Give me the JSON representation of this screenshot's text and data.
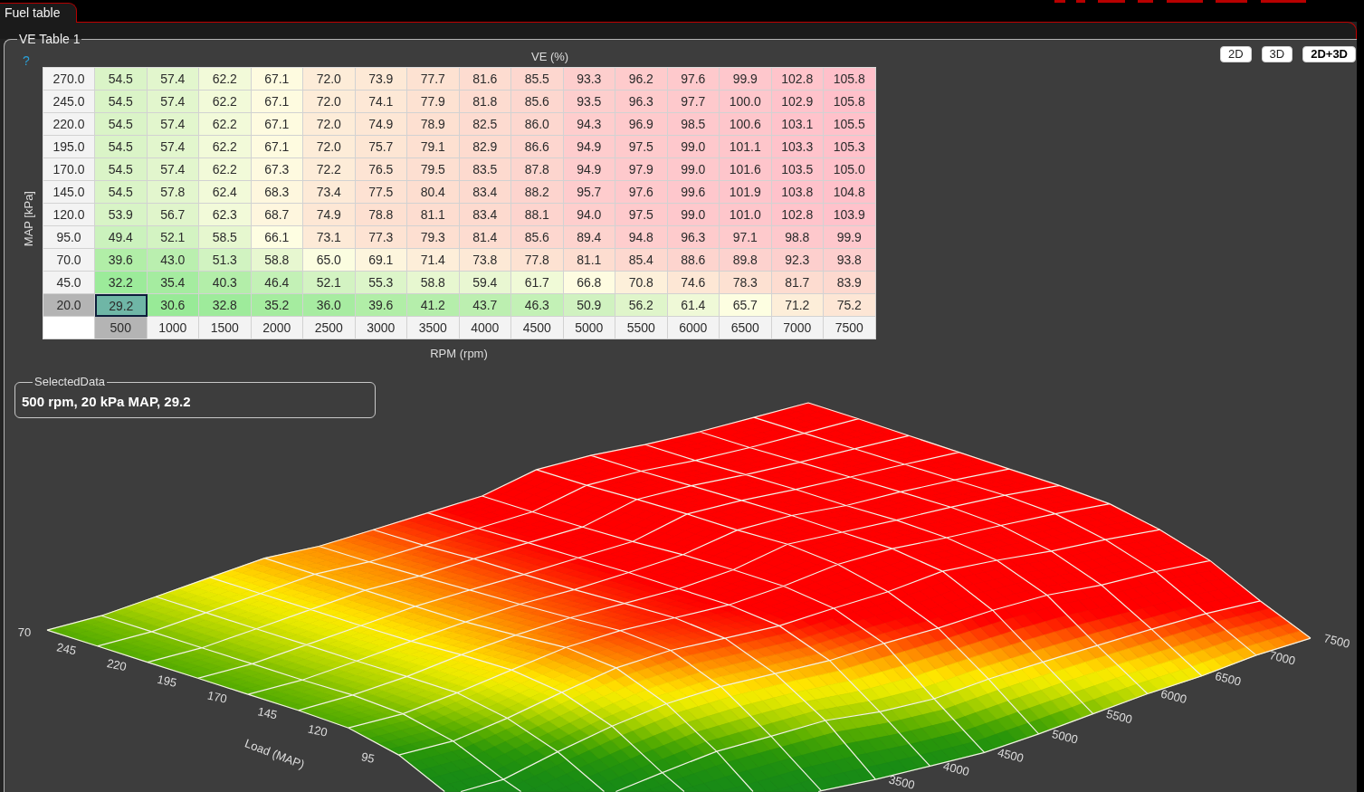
{
  "tabs": [
    {
      "label": "Fuel table",
      "selected": true
    }
  ],
  "ve_table": {
    "title": "VE Table 1",
    "help": "?",
    "value_label": "VE (%)",
    "view_buttons": [
      {
        "label": "2D",
        "selected": false
      },
      {
        "label": "3D",
        "selected": false
      },
      {
        "label": "2D+3D",
        "selected": true
      }
    ],
    "y_axis_label": "MAP [kPa]",
    "x_axis_label": "RPM (rpm)",
    "columns": [
      {
        "label": "500",
        "selected": true
      },
      {
        "label": "1000",
        "selected": false
      },
      {
        "label": "1500",
        "selected": false
      },
      {
        "label": "2000",
        "selected": false
      },
      {
        "label": "2500",
        "selected": false
      },
      {
        "label": "3000",
        "selected": false
      },
      {
        "label": "3500",
        "selected": false
      },
      {
        "label": "4000",
        "selected": false
      },
      {
        "label": "4500",
        "selected": false
      },
      {
        "label": "5000",
        "selected": false
      },
      {
        "label": "5500",
        "selected": false
      },
      {
        "label": "6000",
        "selected": false
      },
      {
        "label": "6500",
        "selected": false
      },
      {
        "label": "7000",
        "selected": false
      },
      {
        "label": "7500",
        "selected": false
      }
    ],
    "rows": [
      {
        "label": "270.0",
        "selected": false,
        "values": [
          "54.5",
          "57.4",
          "62.2",
          "67.1",
          "72.0",
          "73.9",
          "77.7",
          "81.6",
          "85.5",
          "93.3",
          "96.2",
          "97.6",
          "99.9",
          "102.8",
          "105.8"
        ]
      },
      {
        "label": "245.0",
        "selected": false,
        "values": [
          "54.5",
          "57.4",
          "62.2",
          "67.1",
          "72.0",
          "74.1",
          "77.9",
          "81.8",
          "85.6",
          "93.5",
          "96.3",
          "97.7",
          "100.0",
          "102.9",
          "105.8"
        ]
      },
      {
        "label": "220.0",
        "selected": false,
        "values": [
          "54.5",
          "57.4",
          "62.2",
          "67.1",
          "72.0",
          "74.9",
          "78.9",
          "82.5",
          "86.0",
          "94.3",
          "96.9",
          "98.5",
          "100.6",
          "103.1",
          "105.5"
        ]
      },
      {
        "label": "195.0",
        "selected": false,
        "values": [
          "54.5",
          "57.4",
          "62.2",
          "67.1",
          "72.0",
          "75.7",
          "79.1",
          "82.9",
          "86.6",
          "94.9",
          "97.5",
          "99.0",
          "101.1",
          "103.3",
          "105.3"
        ]
      },
      {
        "label": "170.0",
        "selected": false,
        "values": [
          "54.5",
          "57.4",
          "62.2",
          "67.3",
          "72.2",
          "76.5",
          "79.5",
          "83.5",
          "87.8",
          "94.9",
          "97.9",
          "99.0",
          "101.6",
          "103.5",
          "105.0"
        ]
      },
      {
        "label": "145.0",
        "selected": false,
        "values": [
          "54.5",
          "57.8",
          "62.4",
          "68.3",
          "73.4",
          "77.5",
          "80.4",
          "83.4",
          "88.2",
          "95.7",
          "97.6",
          "99.6",
          "101.9",
          "103.8",
          "104.8"
        ]
      },
      {
        "label": "120.0",
        "selected": false,
        "values": [
          "53.9",
          "56.7",
          "62.3",
          "68.7",
          "74.9",
          "78.8",
          "81.1",
          "83.4",
          "88.1",
          "94.0",
          "97.5",
          "99.0",
          "101.0",
          "102.8",
          "103.9"
        ]
      },
      {
        "label": "95.0",
        "selected": false,
        "values": [
          "49.4",
          "52.1",
          "58.5",
          "66.1",
          "73.1",
          "77.3",
          "79.3",
          "81.4",
          "85.6",
          "89.4",
          "94.8",
          "96.3",
          "97.1",
          "98.8",
          "99.9"
        ]
      },
      {
        "label": "70.0",
        "selected": false,
        "values": [
          "39.6",
          "43.0",
          "51.3",
          "58.8",
          "65.0",
          "69.1",
          "71.4",
          "73.8",
          "77.8",
          "81.1",
          "85.4",
          "88.6",
          "89.8",
          "92.3",
          "93.8"
        ]
      },
      {
        "label": "45.0",
        "selected": false,
        "values": [
          "32.2",
          "35.4",
          "40.3",
          "46.4",
          "52.1",
          "55.3",
          "58.8",
          "59.4",
          "61.7",
          "66.8",
          "70.8",
          "74.6",
          "78.3",
          "81.7",
          "83.9"
        ]
      },
      {
        "label": "20.0",
        "selected": true,
        "values": [
          "29.2",
          "30.6",
          "32.8",
          "35.2",
          "36.0",
          "39.6",
          "41.2",
          "43.7",
          "46.3",
          "50.9",
          "56.2",
          "61.4",
          "65.7",
          "71.2",
          "75.2"
        ]
      }
    ]
  },
  "selected_data": {
    "title": "SelectedData",
    "text": "500 rpm, 20 kPa MAP, 29.2"
  },
  "surface_plot": {
    "z_tick_labels": [
      "70"
    ],
    "load_tick_labels": [
      "245",
      "220",
      "195",
      "170",
      "145",
      "120",
      "95"
    ],
    "load_axis_title": "Load (MAP)",
    "rpm_tick_labels": [
      "3500",
      "4000",
      "4500",
      "5000",
      "5500",
      "6000",
      "6500",
      "7000",
      "7500"
    ]
  }
}
